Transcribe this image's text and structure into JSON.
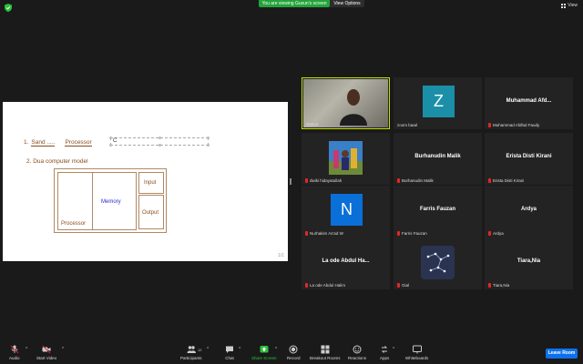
{
  "top": {
    "banner": "You are viewing Gusun's screen",
    "view_options": "View Options",
    "view": "View"
  },
  "shared": {
    "line1_num": "1.",
    "line1_sand": "Sand .....",
    "line1_processor": "Processor",
    "textbox": "C",
    "line2": "2. Dua computer model",
    "processor": "Processor",
    "memory": "Memory",
    "input": "Input",
    "output": "Output",
    "page": "1/1"
  },
  "tiles": [
    {
      "caption": "Gusun",
      "name": "",
      "muted": false,
      "kind": "video"
    },
    {
      "caption": "zoom baaé",
      "name": "",
      "muted": false,
      "kind": "letter",
      "letter": "Z",
      "color": "#1b8fa8"
    },
    {
      "caption": "Muhammad Afdhal Faudy",
      "name": "Muhammad Afd...",
      "muted": true,
      "kind": "name"
    },
    {
      "caption": "dwiki hidayatullah",
      "name": "",
      "muted": true,
      "kind": "pic"
    },
    {
      "caption": "Burhanudin Malik",
      "name": "Burhanudin Malik",
      "muted": true,
      "kind": "name"
    },
    {
      "caption": "Erista Disti Kirani",
      "name": "Erista Disti Kirani",
      "muted": true,
      "kind": "name"
    },
    {
      "caption": "Nurhakim As'ad W",
      "name": "",
      "muted": true,
      "kind": "letter",
      "letter": "N",
      "color": "#0b6fd8"
    },
    {
      "caption": "Farris Fauzan",
      "name": "Farris Fauzan",
      "muted": true,
      "kind": "name"
    },
    {
      "caption": "Ardya",
      "name": "Ardya",
      "muted": true,
      "kind": "name"
    },
    {
      "caption": "La ode Abdul Halim",
      "name": "La ode Abdul Ha...",
      "muted": true,
      "kind": "name"
    },
    {
      "caption": "Gial",
      "name": "",
      "muted": true,
      "kind": "constellation"
    },
    {
      "caption": "Tiara,Nia",
      "name": "Tiara,Nia",
      "muted": true,
      "kind": "name"
    }
  ],
  "toolbar": {
    "audio": "Audio",
    "start_video": "Start Video",
    "participants": "Participants",
    "participants_count": "12",
    "chat": "Chat",
    "share_screen": "Share Screen",
    "record": "Record",
    "breakout": "Breakout Rooms",
    "reactions": "Reactions",
    "apps": "Apps",
    "whiteboards": "Whiteboards",
    "leave": "Leave Room"
  },
  "colors": {
    "accent": "#0e71eb",
    "share": "#2ac23a",
    "muted": "#e02828",
    "active_border": "#c5e000"
  }
}
